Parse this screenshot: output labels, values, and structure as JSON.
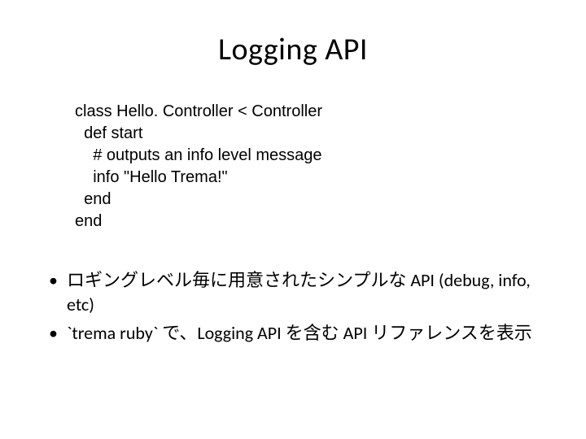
{
  "title": "Logging API",
  "code": {
    "line1": "class Hello. Controller < Controller",
    "line2": "  def start",
    "line3": "    # outputs an info level message",
    "line4": "    info \"Hello Trema!\"",
    "line5": "  end",
    "line6": "end"
  },
  "bullets": {
    "item1": "ロギングレベル毎に用意されたシンプルな API (debug, info, etc)",
    "item2": "`trema ruby` で、Logging API を含む API リファレンスを表示"
  }
}
